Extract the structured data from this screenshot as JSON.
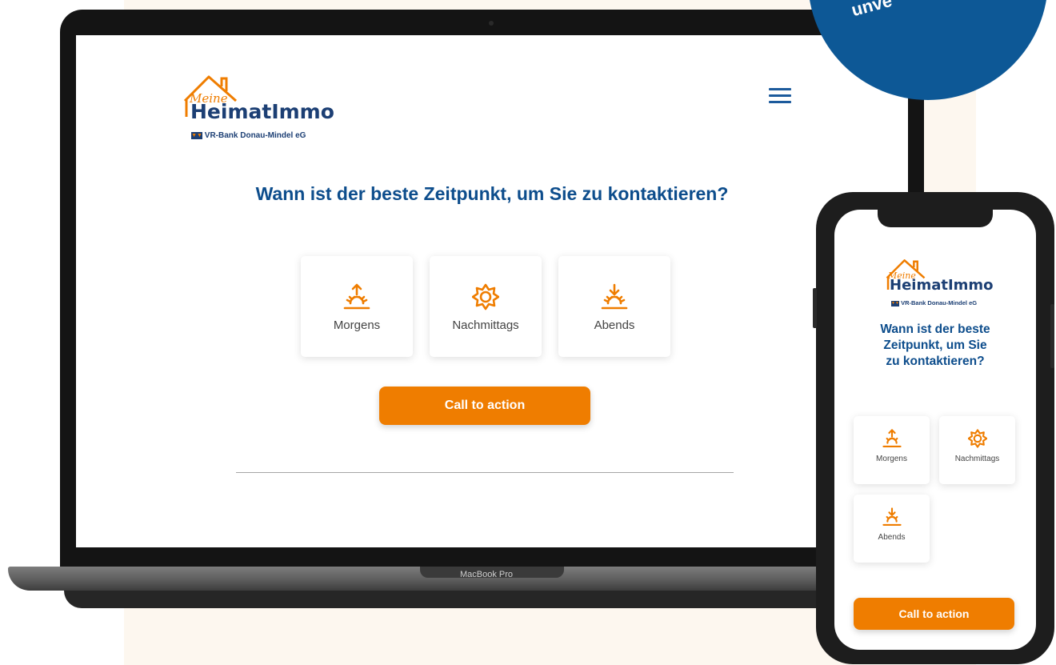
{
  "badge": {
    "text": "unve"
  },
  "brand": {
    "script": "Meine",
    "name": "HeimatImmo",
    "bank": "VR-Bank Donau-Mindel eG"
  },
  "laptop": {
    "label": "MacBook Pro",
    "question": "Wann ist der beste Zeitpunkt, um Sie zu kontaktieren?",
    "options": [
      {
        "label": "Morgens",
        "icon": "sunrise-icon"
      },
      {
        "label": "Nachmittags",
        "icon": "sun-icon"
      },
      {
        "label": "Abends",
        "icon": "sunset-icon"
      }
    ],
    "cta": "Call to action"
  },
  "phone": {
    "question": [
      "Wann ist der beste",
      "Zeitpunkt, um Sie",
      "zu kontaktieren?"
    ],
    "options": [
      {
        "label": "Morgens",
        "icon": "sunrise-icon"
      },
      {
        "label": "Nachmittags",
        "icon": "sun-icon"
      },
      {
        "label": "Abends",
        "icon": "sunset-icon"
      }
    ],
    "cta": "Call to action"
  },
  "colors": {
    "orange": "#ef7d00",
    "navy": "#1c3f74",
    "title_blue": "#0d4d8c",
    "badge_blue": "#0d5896"
  }
}
